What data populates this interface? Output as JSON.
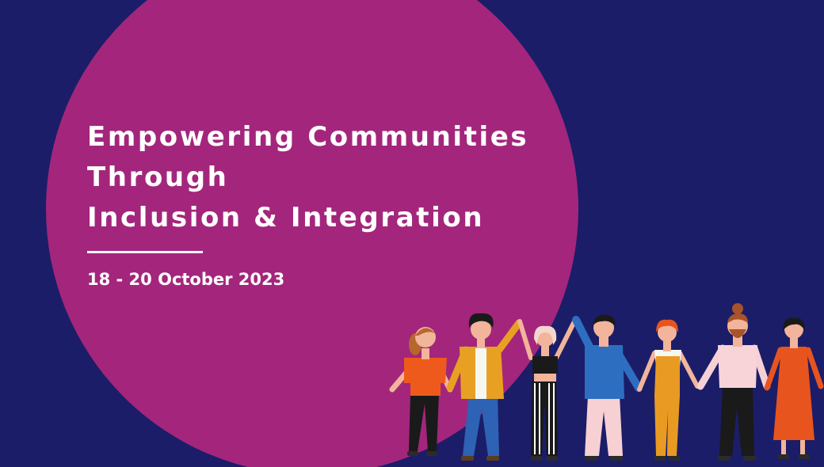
{
  "banner": {
    "headline_lines": [
      "Empowering Communities",
      "Through",
      "Inclusion & Integration"
    ],
    "date": "18 - 20 October 2023"
  },
  "colors": {
    "background": "#1b1d68",
    "circle": "#a3267c",
    "text": "#ffffff"
  },
  "illustration": {
    "icon": "people-holding-hands-illustration"
  }
}
